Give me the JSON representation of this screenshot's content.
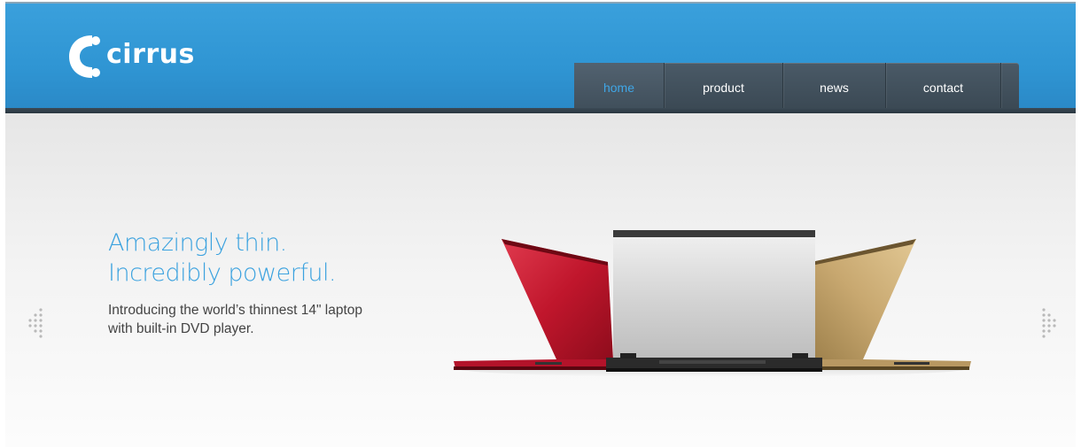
{
  "brand": {
    "name": "cirrus"
  },
  "nav": {
    "items": [
      {
        "label": "home",
        "active": true
      },
      {
        "label": "product",
        "active": false
      },
      {
        "label": "news",
        "active": false
      },
      {
        "label": "contact",
        "active": false
      }
    ]
  },
  "hero": {
    "headline_line1": "Amazingly thin.",
    "headline_line2": "Incredibly powerful.",
    "subcopy_line1": "Introducing the world’s thinnest 14\" laptop",
    "subcopy_line2": "with built-in DVD player.",
    "image_icon": "laptop-trio-image"
  },
  "controls": {
    "prev_icon": "slider-prev-arrow-icon",
    "next_icon": "slider-next-arrow-icon"
  },
  "colors": {
    "header_blue": "#3aa0dc",
    "nav_dark": "#3a4853",
    "nav_active_text": "#3fa6e6",
    "headline_blue": "#3ba2df",
    "laptop_red": "#c0162c",
    "laptop_silver": "#d4d4d4",
    "laptop_gold": "#c8a870"
  }
}
